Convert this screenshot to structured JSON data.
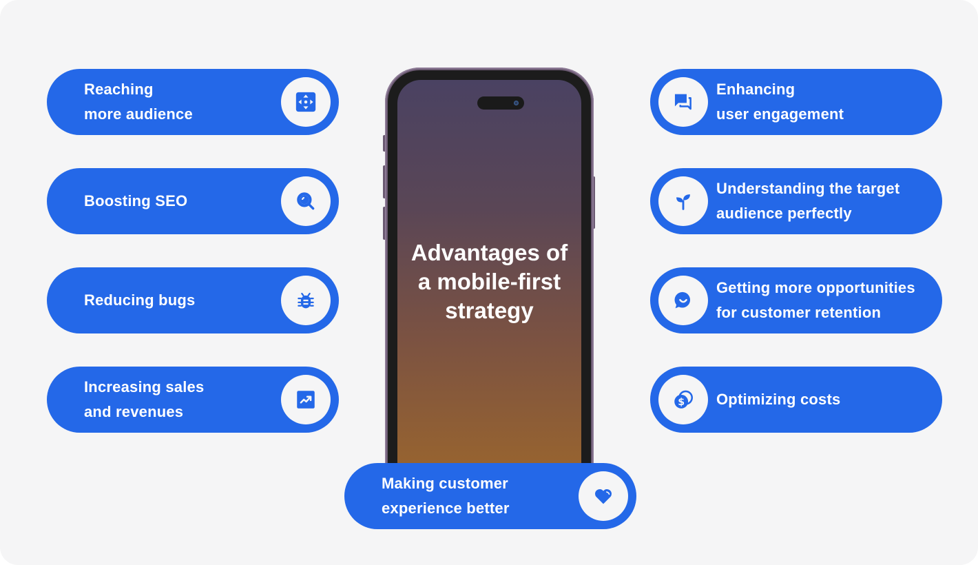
{
  "title": "Advantages of\na mobile-first\nstrategy",
  "colors": {
    "accent": "#2468e8",
    "background": "#f5f5f6",
    "text_on_accent": "#ffffff"
  },
  "left_items": [
    {
      "label": "Reaching\nmore audience",
      "icon": "move-arrows-icon"
    },
    {
      "label": "Boosting SEO",
      "icon": "search-icon"
    },
    {
      "label": "Reducing bugs",
      "icon": "bug-icon"
    },
    {
      "label": "Increasing sales\nand revenues",
      "icon": "trending-up-icon"
    }
  ],
  "right_items": [
    {
      "label": "Enhancing\nuser engagement",
      "icon": "chat-bubbles-icon"
    },
    {
      "label": "Understanding the target\naudience perfectly",
      "icon": "sprout-icon"
    },
    {
      "label": "Getting more opportunities\nfor customer retention",
      "icon": "smile-chat-icon"
    },
    {
      "label": "Optimizing costs",
      "icon": "coins-icon"
    }
  ],
  "bottom_item": {
    "label": "Making customer\nexperience better",
    "icon": "heart-icon"
  }
}
